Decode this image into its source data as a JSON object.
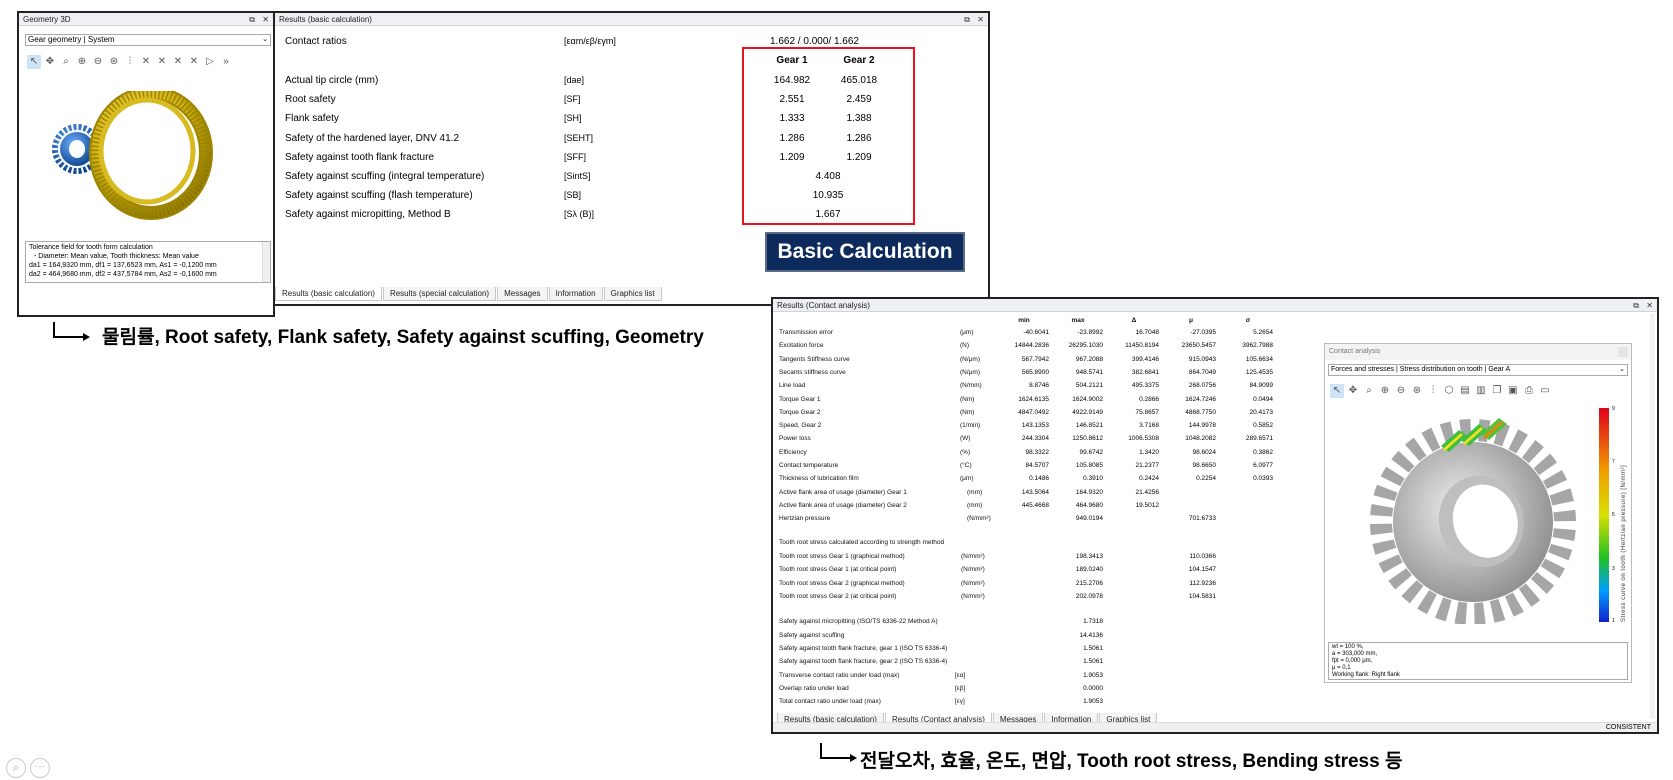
{
  "geometry": {
    "title": "Geometry 3D",
    "selector": "Gear geometry | System",
    "info_lines": [
      "Tolerance field for tooth form calculation",
      "- Diameter: Mean value, Tooth thickness: Mean value",
      "da1 = 164,9320 mm, df1 = 137,6523 mm, As1 = -0,1200 mm",
      "da2 = 464,9680 mm, df2 = 437,5784 mm, As2 = -0,1600 mm"
    ]
  },
  "basic": {
    "title": "Results (basic calculation)",
    "contact_ratios": {
      "label": "Contact ratios",
      "symbol": "[εαm/εβ/εγm]",
      "value": "1.662 / 0.000/ 1.662"
    },
    "gear1_header": "Gear 1",
    "gear2_header": "Gear 2",
    "rows": [
      {
        "label": "Actual tip circle (mm)",
        "symbol": "[dae]",
        "g1": "164.982",
        "g2": "465.018"
      },
      {
        "label": "Root safety",
        "symbol": "[SF]",
        "g1": "2.551",
        "g2": "2.459"
      },
      {
        "label": "Flank safety",
        "symbol": "[SH]",
        "g1": "1.333",
        "g2": "1.388"
      },
      {
        "label": "Safety of the hardened layer, DNV 41.2",
        "symbol": "[SEHT]",
        "g1": "1.286",
        "g2": "1.286"
      },
      {
        "label": "Safety against tooth flank fracture",
        "symbol": "[SFF]",
        "g1": "1.209",
        "g2": "1.209"
      },
      {
        "label": "Safety against scuffing (integral temperature)",
        "symbol": "[SintS]",
        "single": "4.408"
      },
      {
        "label": "Safety against scuffing (flash temperature)",
        "symbol": "[SB]",
        "single": "10.935"
      },
      {
        "label": "Safety against micropitting, Method B",
        "symbol": "[Sλ (B)]",
        "single": "1.667"
      }
    ],
    "tabs": [
      "Results (basic calculation)",
      "Results (special calculation)",
      "Messages",
      "Information",
      "Graphics list"
    ],
    "badge": "Basic Calculation",
    "colors": {
      "highlight": "#e8151b",
      "badge_bg": "#0c2a5c"
    }
  },
  "caption1": "물림률, Root safety, Flank safety, Safety against scuffing, Geometry",
  "caption2": "전달오차, 효율, 온도, 면압, Tooth root stress, Bending stress 등",
  "contact": {
    "title": "Results (Contact analysis)",
    "headers": [
      "min",
      "max",
      "Δ",
      "μ",
      "σ"
    ],
    "rows": [
      {
        "label": "Transmission error",
        "unit": "(μm)",
        "v": [
          "-40.6041",
          "-23.8992",
          "16.7048",
          "-27.0395",
          "5.2654"
        ]
      },
      {
        "label": "Excitation force",
        "unit": "(N)",
        "v": [
          "14844.2836",
          "26295.1030",
          "11450.8194",
          "23650.5457",
          "3962.7988"
        ]
      },
      {
        "label": "Tangents Stiffness curve",
        "unit": "(N/μm)",
        "v": [
          "567.7942",
          "967.2088",
          "399.4146",
          "915.0943",
          "105.6634"
        ]
      },
      {
        "label": "Secants stiffness curve",
        "unit": "(N/μm)",
        "v": [
          "565.8900",
          "948.5741",
          "382.6841",
          "864.7049",
          "125.4535"
        ]
      },
      {
        "label": "Line load",
        "unit": "(N/mm)",
        "v": [
          "8.8746",
          "504.2121",
          "495.3375",
          "268.0756",
          "84.9099"
        ]
      },
      {
        "label": "Torque Gear 1",
        "unit": "(Nm)",
        "v": [
          "1624.6135",
          "1624.9002",
          "0.2866",
          "1624.7246",
          "0.0494"
        ]
      },
      {
        "label": "Torque Gear 2",
        "unit": "(Nm)",
        "v": [
          "4847.0492",
          "4922.9149",
          "75.8657",
          "4868.7750",
          "20.4173"
        ]
      },
      {
        "label": "Speed, Gear 2",
        "unit": "(1/min)",
        "v": [
          "143.1353",
          "146.8521",
          "3.7168",
          "144.9978",
          "0.5852"
        ]
      },
      {
        "label": "Power loss",
        "unit": "(W)",
        "v": [
          "244.3304",
          "1250.8612",
          "1006.5308",
          "1048.2082",
          "289.6571"
        ]
      },
      {
        "label": "Efficiency",
        "unit": "(%)",
        "v": [
          "98.3322",
          "99.6742",
          "1.3420",
          "98.6024",
          "0.3862"
        ]
      },
      {
        "label": "Contact temperature",
        "unit": "(°C)",
        "v": [
          "84.5707",
          "105.8085",
          "21.2377",
          "98.6650",
          "6.0977"
        ]
      },
      {
        "label": "Thickness of lubrication film",
        "unit": "(μm)",
        "v": [
          "0.1486",
          "0.3910",
          "0.2424",
          "0.2254",
          "0.0393"
        ]
      },
      {
        "label": "Active flank area of usage (diameter) Gear 1",
        "unit": "(mm)",
        "v": [
          "143.5064",
          "164.9320",
          "21.4256",
          "",
          ""
        ]
      },
      {
        "label": "Active flank area of usage (diameter) Gear 2",
        "unit": "(mm)",
        "v": [
          "445.4668",
          "464.9680",
          "19.5012",
          "",
          ""
        ]
      },
      {
        "label": "Hertzian pressure",
        "unit": "(N/mm²)",
        "v": [
          "",
          "949.0194",
          "",
          "701.6733",
          ""
        ]
      }
    ],
    "section2": "Tooth root stress calculated according to strength method",
    "stress_rows": [
      {
        "label": "Tooth root stress Gear 1 (graphical method)",
        "unit": "(N/mm²)",
        "max": "198.3413",
        "mu": "110.0366"
      },
      {
        "label": "Tooth root stress Gear 1 (at critical point)",
        "unit": "(N/mm²)",
        "max": "189.0240",
        "mu": "104.1547"
      },
      {
        "label": "Tooth root stress Gear 2 (graphical method)",
        "unit": "(N/mm²)",
        "max": "215.2706",
        "mu": "112.9236"
      },
      {
        "label": "Tooth root stress Gear 2 (at critical point)",
        "unit": "(N/mm²)",
        "max": "202.0978",
        "mu": "104.5831"
      }
    ],
    "safety_rows": [
      {
        "label": "Safety against micropitting (ISO/TS 6336-22 Method A)",
        "unit": "",
        "val": "1.7318"
      },
      {
        "label": "Safety against scuffing",
        "unit": "",
        "val": "14.4136"
      },
      {
        "label": "Safety against tooth flank fracture, gear 1 (ISO TS 6336-4)",
        "unit": "",
        "val": "1.5061"
      },
      {
        "label": "Safety against tooth flank fracture, gear 2 (ISO TS 6336-4)",
        "unit": "",
        "val": "1.5061"
      },
      {
        "label": "Transverse contact ratio under load (max)",
        "unit": "[εα]",
        "val": "1.9053"
      },
      {
        "label": "Overlap ratio under load",
        "unit": "[εβ]",
        "val": "0.0000"
      },
      {
        "label": "Total contact ratio under load (max)",
        "unit": "[εγ]",
        "val": "1.9053"
      }
    ],
    "tabs": [
      "Results (basic calculation)",
      "Results (Contact analysis)",
      "Messages",
      "Information",
      "Graphics list"
    ],
    "status": "CONSISTENT",
    "subwin": {
      "title": "Contact analysis",
      "selector": "Forces and stresses | Stress distribution on tooth | Gear A",
      "colorbar_label": "Stress curve on tooth (Hertzian pressure) [N/mm²]",
      "scale_ticks": [
        "9",
        "7",
        "5",
        "3",
        "1"
      ],
      "info_lines": [
        "wt = 100 %,",
        "a = 303,000 mm,",
        "fpt = 0,000 μm,",
        "μ = 0,1",
        "Working flank: Right flank"
      ]
    }
  }
}
